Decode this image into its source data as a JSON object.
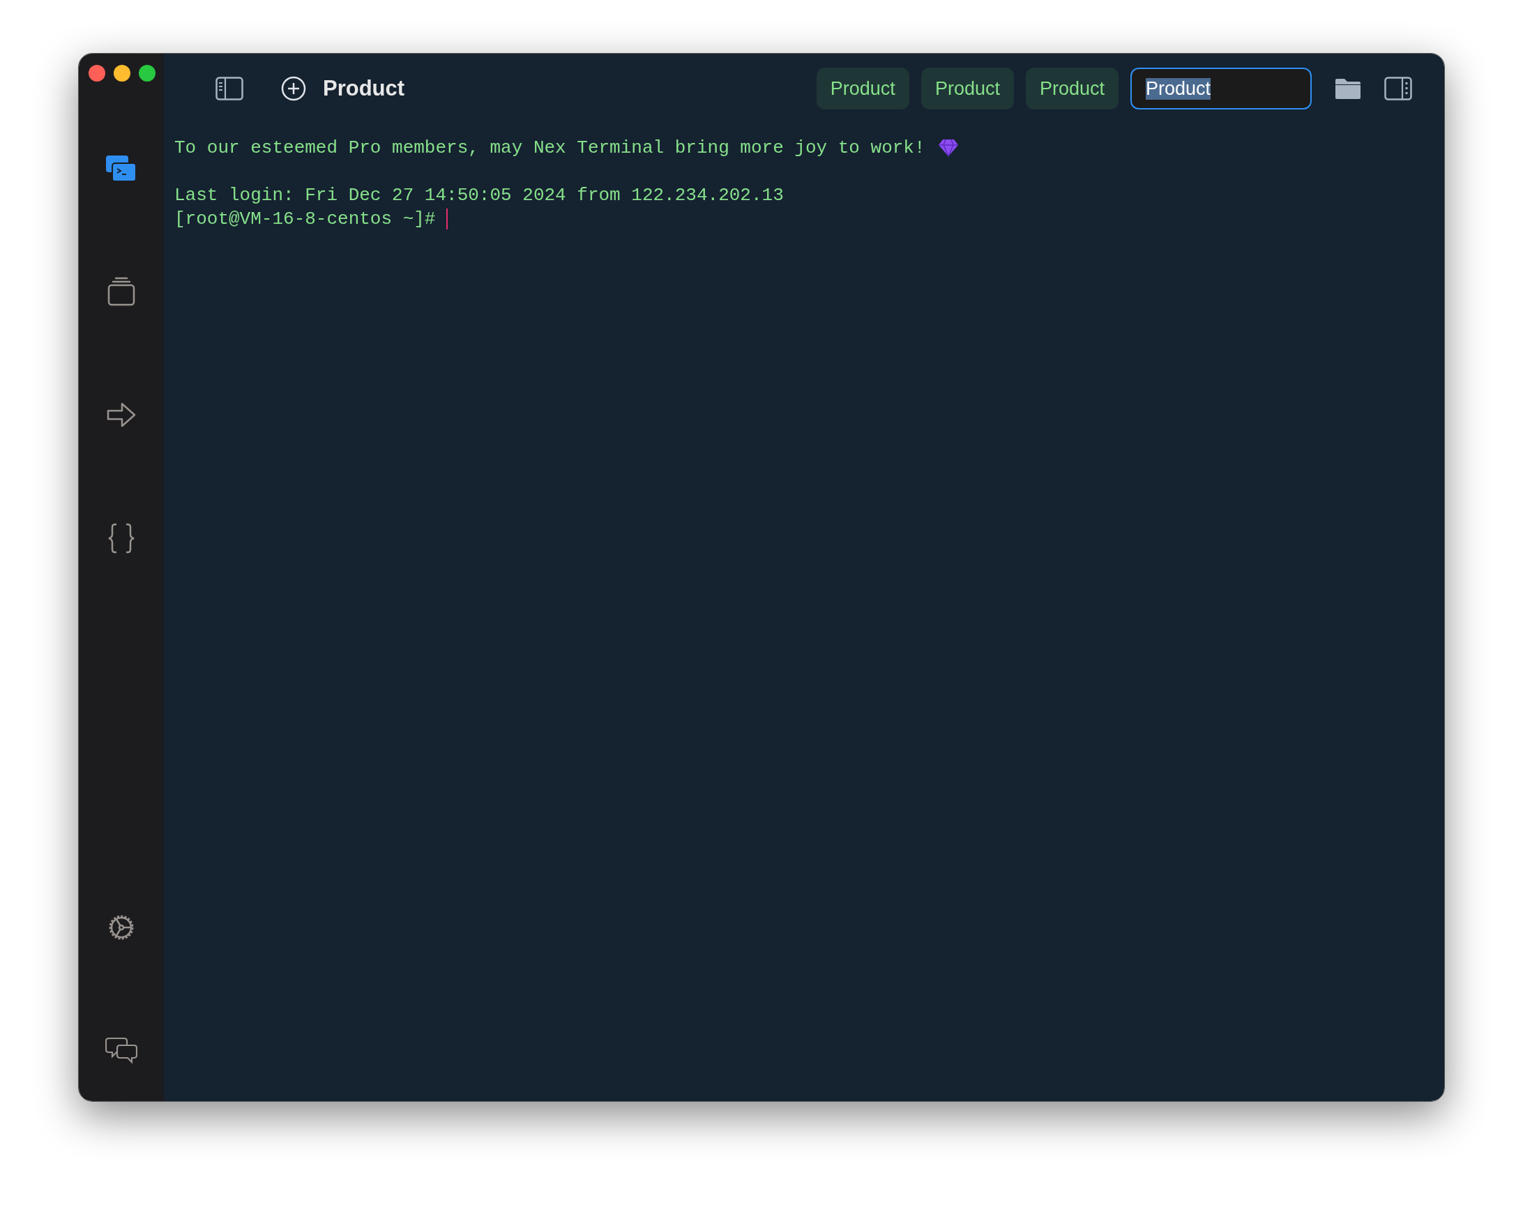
{
  "sidebar": {
    "top_items": [
      {
        "kind": "terminal",
        "selected": true
      },
      {
        "kind": "layers",
        "selected": false
      },
      {
        "kind": "arrow",
        "selected": false
      },
      {
        "kind": "braces",
        "selected": false
      }
    ],
    "bottom_items": [
      {
        "kind": "gear",
        "selected": false
      },
      {
        "kind": "chat",
        "selected": false
      }
    ]
  },
  "toolbar": {
    "title": "Product",
    "tabs": [
      {
        "label": "Product"
      },
      {
        "label": "Product"
      },
      {
        "label": "Product"
      }
    ],
    "rename_field": {
      "value": "Product",
      "text_selected": true
    }
  },
  "terminal": {
    "lines": [
      {
        "kind": "banner",
        "text": "To our esteemed Pro members, may Nex Terminal bring more joy to work!"
      },
      {
        "kind": "blank"
      },
      {
        "kind": "output",
        "text": "Last login: Fri Dec 27 14:50:05 2024 from 122.234.202.13"
      },
      {
        "kind": "prompt",
        "text": "[root@VM-16-8-centos ~]#"
      }
    ]
  }
}
